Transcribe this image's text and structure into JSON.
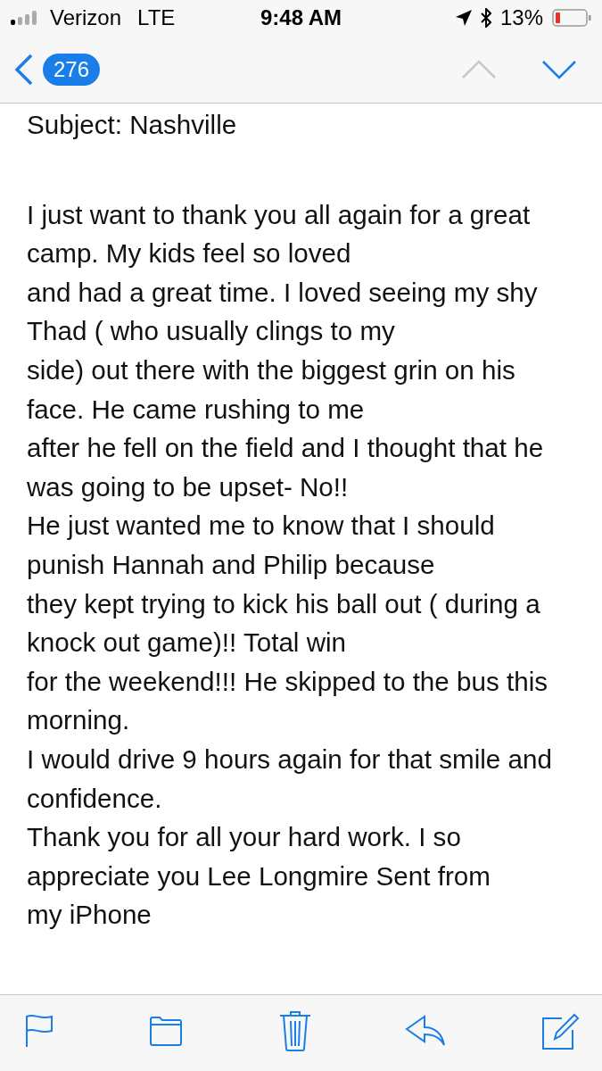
{
  "status_bar": {
    "carrier": "Verizon",
    "network": "LTE",
    "time": "9:48 AM",
    "battery_percent": "13%"
  },
  "nav_bar": {
    "unread_count": "276",
    "buttons": [
      {
        "kind": "up",
        "disabled": true
      },
      {
        "kind": "down",
        "disabled": false
      }
    ]
  },
  "message": {
    "subject": "Subject: Nashville",
    "lines": [
      "I just want to thank you all again for a great camp. My kids feel so loved",
      "and had a great time. I loved seeing my shy Thad ( who usually clings to my",
      "side) out there with the biggest grin on his face. He came rushing to me",
      "after he fell on the field and I thought that he was going to be upset- No!!",
      "He just wanted me to know that I should punish Hannah and Philip because",
      "they kept trying to kick his ball out ( during a knock out game)!! Total win",
      "for the weekend!!! He skipped to the bus this morning.",
      "I would drive 9 hours again for that smile and confidence.",
      "Thank you for all your hard work. I so appreciate you Lee Longmire Sent from",
      "my iPhone"
    ]
  },
  "toolbar": [
    {
      "kind": "flag"
    },
    {
      "kind": "folder"
    },
    {
      "kind": "trash"
    },
    {
      "kind": "reply"
    },
    {
      "kind": "compose"
    }
  ]
}
